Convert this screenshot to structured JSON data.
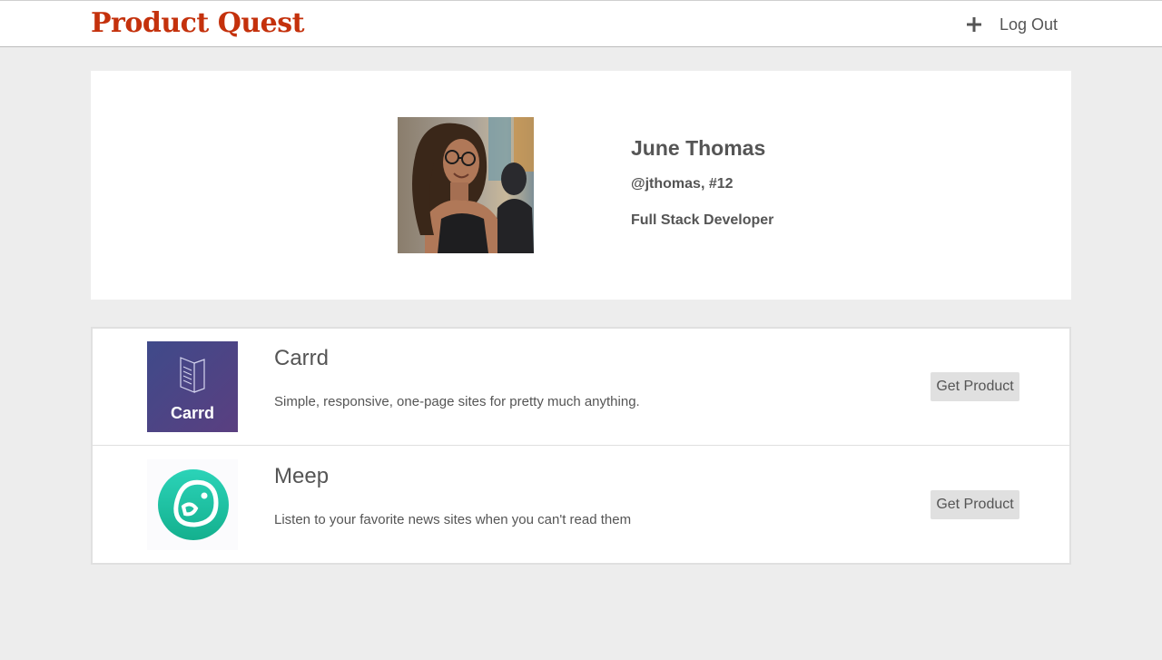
{
  "header": {
    "brand": "Product Quest",
    "add_icon": "plus-icon",
    "logout_label": "Log Out",
    "brand_color": "#c4310c"
  },
  "profile": {
    "name": "June Thomas",
    "handle": "@jthomas, #12",
    "title": "Full Stack Developer",
    "avatar_icon": "profile-photo"
  },
  "products": [
    {
      "name": "Carrd",
      "description": "Simple, responsive, one-page sites for pretty much anything.",
      "logo_text": "Carrd",
      "logo_icon": "carrd-logo",
      "button_label": "Get Product"
    },
    {
      "name": "Meep",
      "description": "Listen to your favorite news sites when you can't read them",
      "logo_icon": "meep-bird-logo",
      "button_label": "Get Product"
    }
  ],
  "colors": {
    "page_bg": "#ededed",
    "card_bg": "#ffffff",
    "button_bg": "#e0e0e0",
    "carrd_logo_bg_start": "#3f4a8a",
    "carrd_logo_bg_end": "#5a3f80",
    "meep_teal": "#1cbf9f"
  }
}
